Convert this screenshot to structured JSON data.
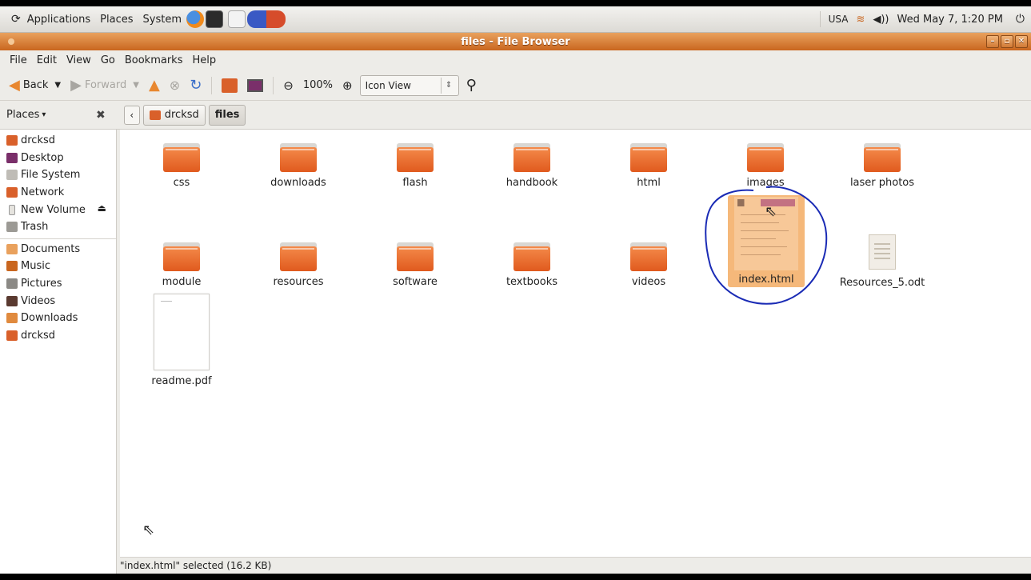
{
  "top_panel": {
    "menus": [
      "Applications",
      "Places",
      "System"
    ],
    "keyboard_layout": "USA",
    "datetime": "Wed May 7, 1:20 PM"
  },
  "window": {
    "title": "files - File Browser"
  },
  "menubar": [
    "File",
    "Edit",
    "View",
    "Go",
    "Bookmarks",
    "Help"
  ],
  "toolbar": {
    "back_label": "Back",
    "forward_label": "Forward",
    "zoom_level": "100%",
    "view_mode": "Icon View"
  },
  "location": {
    "places_label": "Places",
    "breadcrumbs": [
      "drcksd",
      "files"
    ]
  },
  "sidebar": {
    "devices": [
      "drcksd",
      "Desktop",
      "File System",
      "Network",
      "New Volume",
      "Trash"
    ],
    "bookmarks": [
      "Documents",
      "Music",
      "Pictures",
      "Videos",
      "Downloads",
      "drcksd"
    ]
  },
  "files": {
    "row1": [
      "css",
      "downloads",
      "flash",
      "handbook",
      "html",
      "images",
      "laser photos"
    ],
    "row2": [
      "module",
      "resources",
      "software",
      "textbooks",
      "videos",
      "index.html",
      "Resources_5.odt"
    ],
    "row3": [
      "readme.pdf"
    ]
  },
  "status": "\"index.html\" selected (16.2 KB)",
  "colors": {
    "accent": "#e05a1e",
    "titlebar": "#c9661f",
    "selection": "#f5b87a",
    "annotation": "#1a2bb5"
  }
}
